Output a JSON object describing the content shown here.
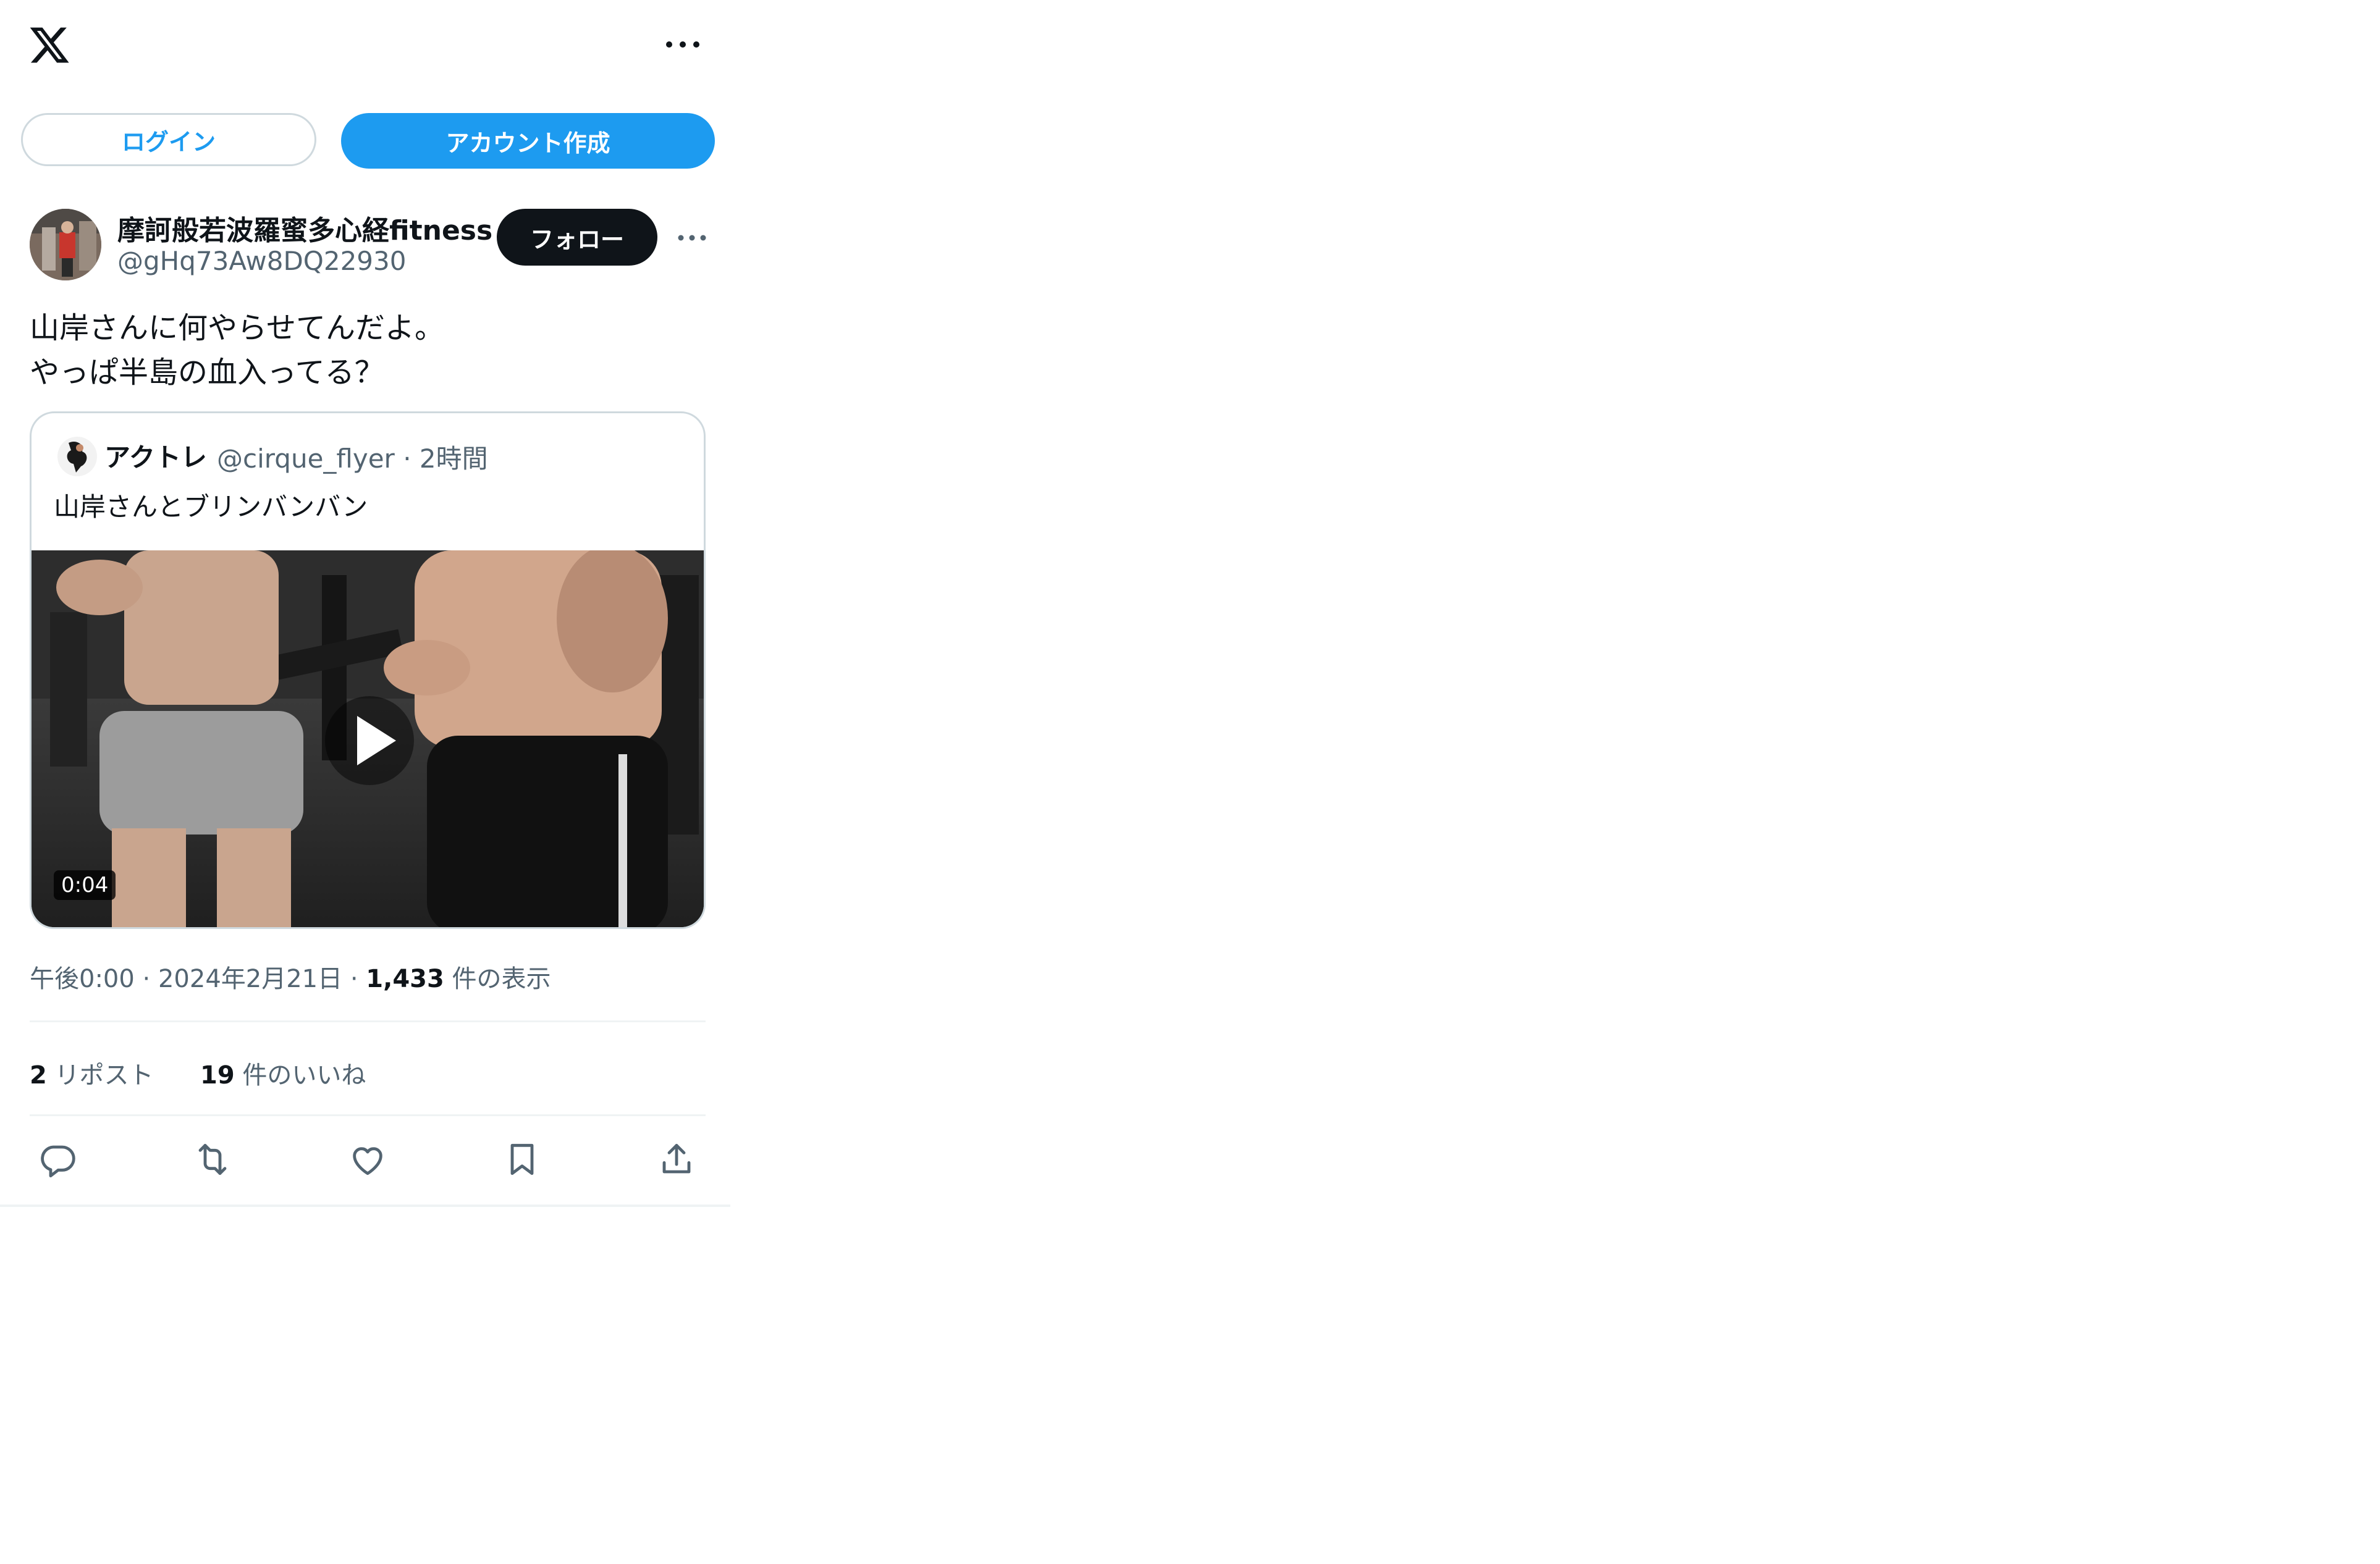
{
  "header": {
    "logo_icon": "x-logo-icon",
    "more_icon": "more-horizontal-icon"
  },
  "auth": {
    "login_label": "ログイン",
    "create_account_label": "アカウント作成"
  },
  "tweet": {
    "author_name": "摩訶般若波羅蜜多心経fitness",
    "author_handle": "@gHq73Aw8DQ22930",
    "follow_label": "フォロー",
    "text": "山岸さんに何やらせてんだよ。\nやっぱ半島の血入ってる？",
    "quote": {
      "author_name": "アクトレ",
      "author_handle": "@cirque_flyer",
      "time": "2時間",
      "text": "山岸さんとブリンバンバン",
      "video_duration": "0:04"
    },
    "meta": {
      "time": "午後0:00",
      "date": "2024年2月21日",
      "views_count": "1,433",
      "views_label": "件の表示"
    },
    "stats": {
      "reposts_count": "2",
      "reposts_label": "リポスト",
      "likes_count": "19",
      "likes_label": "件のいいね"
    },
    "actions": [
      "reply-icon",
      "repost-icon",
      "like-icon",
      "bookmark-icon",
      "share-icon"
    ]
  },
  "colors": {
    "accent": "#1d9bf0",
    "text_primary": "#0f1419",
    "text_secondary": "#536471",
    "border": "#cfd9de"
  }
}
